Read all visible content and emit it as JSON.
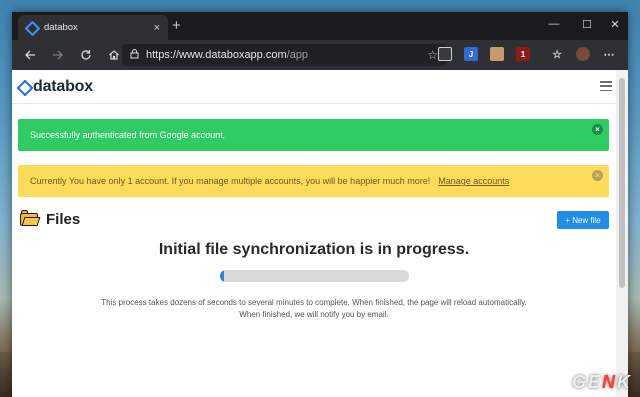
{
  "browser": {
    "tab_title": "databox",
    "tab_close": "×",
    "new_tab": "+",
    "window_controls": {
      "minimize": "—",
      "maximize": "☐",
      "close": "✕"
    },
    "url_host": "https://www.databoxapp.com",
    "url_path": "/app",
    "nav_icons": [
      "back-icon",
      "forward-icon",
      "refresh-icon",
      "home-icon"
    ],
    "extensions": [
      "extension-icon",
      "j-extension-icon",
      "portrait-extension-icon",
      "ublock-icon",
      "favorites-icon",
      "profile-icon"
    ],
    "extension_labels": {
      "j": "J",
      "ublock_badge": "1"
    }
  },
  "app": {
    "logo_text": "databox",
    "alerts": {
      "success": "Successfully authenticated from Google account.",
      "warning": "Currently You have only 1 account. If you manage multiple accounts, you will be happier much more!",
      "warning_link": "Manage accounts",
      "close": "×"
    },
    "files": {
      "title": "Files",
      "new_file_button": "+ New file"
    },
    "sync": {
      "title": "Initial file synchronization is in progress.",
      "progress": 0.02,
      "line1": "This process takes dozens of seconds to several minutes to complete. When finished, the page will reload automatically.",
      "line2": "When finished, we will notify you by email."
    }
  },
  "watermark": {
    "prefix": "GE",
    "accent": "N",
    "suffix": "K"
  },
  "colors": {
    "success": "#2ecc63",
    "warning": "#fddb5b",
    "primary": "#1f8ee8",
    "progress": "#2383e2"
  }
}
